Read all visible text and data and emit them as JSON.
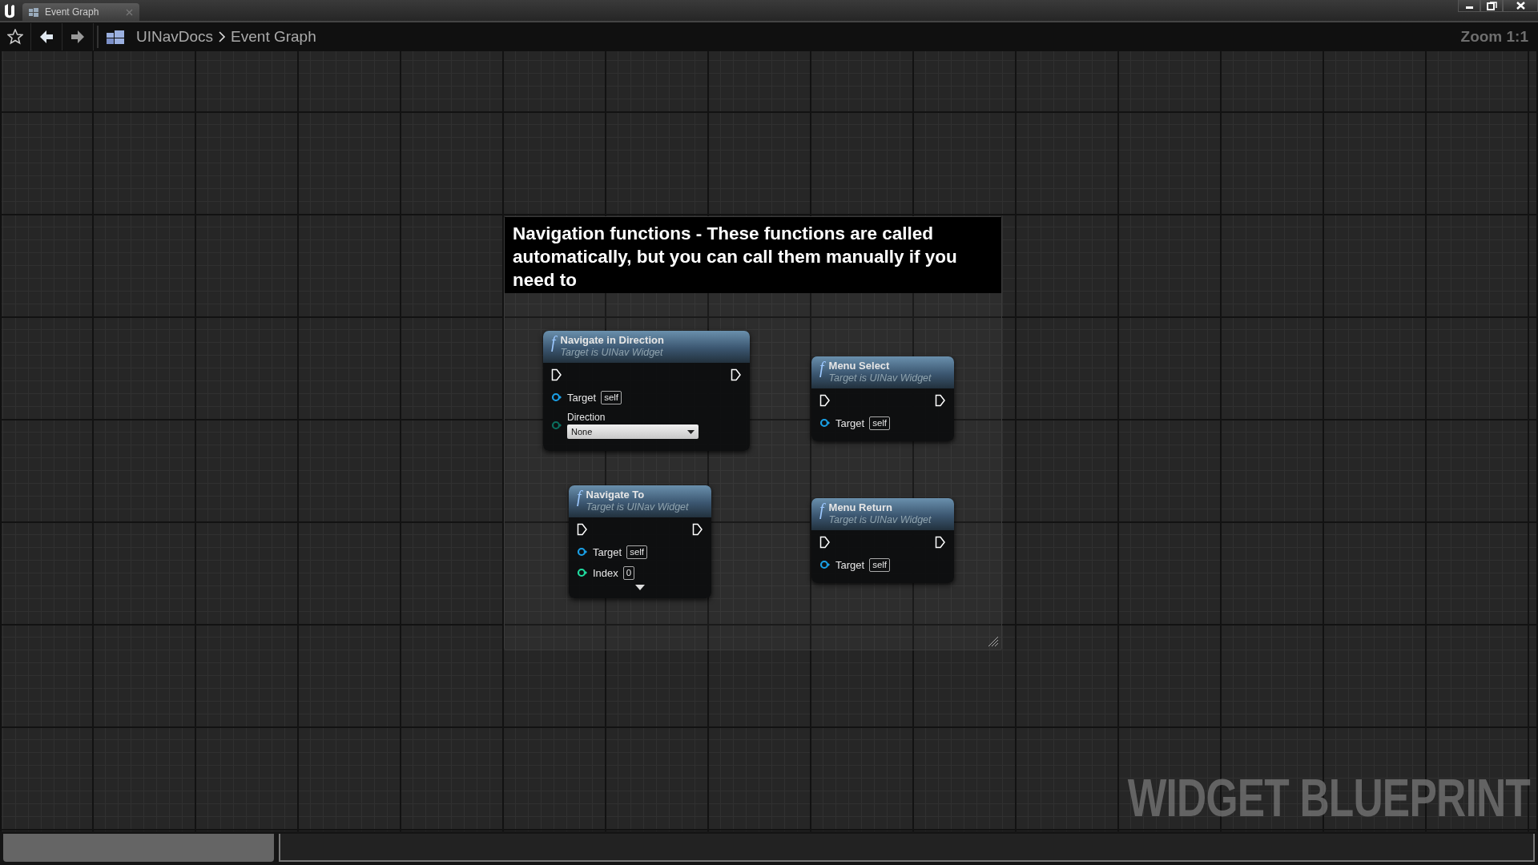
{
  "window": {
    "tabs": [
      {
        "label": "Event Graph",
        "selected": true
      }
    ]
  },
  "toolbar": {
    "breadcrumb": [
      "UINavDocs",
      "Event Graph"
    ]
  },
  "graph": {
    "zoom_label": "Zoom 1:1",
    "watermark": "WIDGET BLUEPRINT",
    "comment": {
      "text": "Navigation functions - These functions are called automatically, but you can call them manually if you need to"
    },
    "nodes": [
      {
        "icon": "f",
        "title": "Navigate in Direction",
        "subtitle": "Target is UINav Widget",
        "expandable": false,
        "pins": [
          {
            "kind": "exec"
          },
          {
            "kind": "object",
            "label": "Target",
            "value": "self"
          },
          {
            "kind": "enum",
            "label": "Direction",
            "value": "None"
          }
        ]
      },
      {
        "icon": "f",
        "title": "Menu Select",
        "subtitle": "Target is UINav Widget",
        "expandable": false,
        "pins": [
          {
            "kind": "exec"
          },
          {
            "kind": "object",
            "label": "Target",
            "value": "self"
          }
        ]
      },
      {
        "icon": "f",
        "title": "Navigate To",
        "subtitle": "Target is UINav Widget",
        "expandable": true,
        "pins": [
          {
            "kind": "exec"
          },
          {
            "kind": "object",
            "label": "Target",
            "value": "self"
          },
          {
            "kind": "int",
            "label": "Index",
            "value": "0"
          }
        ]
      },
      {
        "icon": "f",
        "title": "Menu Return",
        "subtitle": "Target is UINav Widget",
        "expandable": false,
        "pins": [
          {
            "kind": "exec"
          },
          {
            "kind": "object",
            "label": "Target",
            "value": "self"
          }
        ]
      }
    ]
  }
}
